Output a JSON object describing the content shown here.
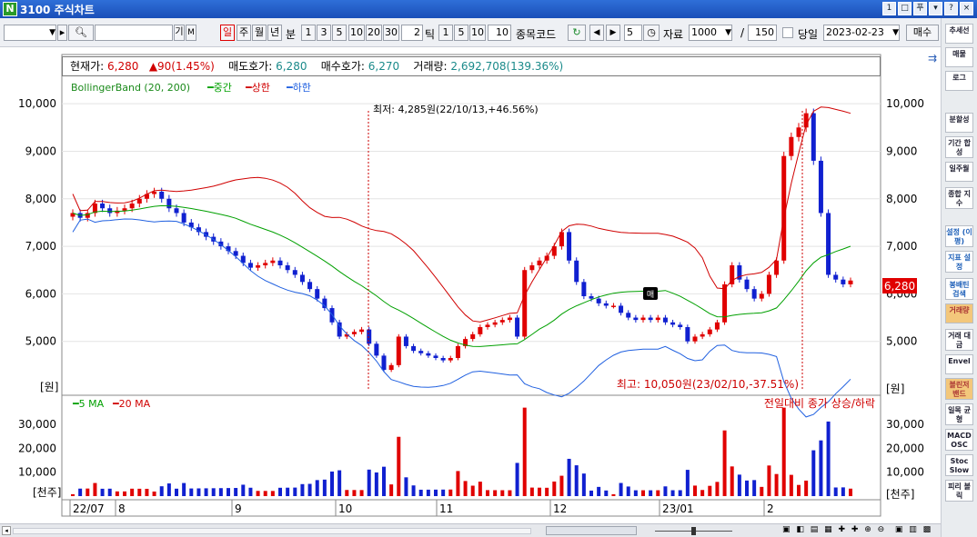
{
  "window": {
    "icon_letter": "N",
    "title": "3100 주식차트",
    "buttons": [
      "1",
      "□",
      "푸",
      "▾",
      "?",
      "×"
    ]
  },
  "toolbar": {
    "periods": [
      "일",
      "주",
      "월",
      "년",
      "분"
    ],
    "minute_values": [
      "1",
      "3",
      "5",
      "10",
      "20",
      "30"
    ],
    "tick_count": "2",
    "tick_label": "틱",
    "tick_values": [
      "1",
      "5",
      "10",
      "10"
    ],
    "code_label": "종목코드",
    "count_value": "5",
    "data_label": "자료",
    "data_count": "1000",
    "slash": "/",
    "view_count": "150",
    "today_label": "당일",
    "date_value": "2023-02-23",
    "trade_type": "매수"
  },
  "sidebar": [
    "추세선",
    "매물",
    "로그",
    "분할성",
    "기간 합성",
    "일주월",
    "종합 지수",
    "설정 (이평)",
    "지표 설정",
    "봉배틴 검색",
    "거래량",
    "거래 대금",
    "Envel",
    "볼린저 밴드",
    "일목 균형",
    "MACD OSC",
    "Stoc Slow",
    "피리 볼릭"
  ],
  "info": {
    "current_label": "현재가:",
    "current_value": "6,280",
    "change": "▲90(1.45%)",
    "ask_label": "매도호가:",
    "ask_value": "6,280",
    "bid_label": "매수호가:",
    "bid_value": "6,270",
    "volume_label": "거래량:",
    "volume_value": "2,692,708(139.36%)"
  },
  "legend": {
    "title": "BollingerBand (20, 200)",
    "mid": "━중간",
    "upper": "━상한",
    "lower": "━하한"
  },
  "annotations": {
    "low": "최저: 4,285원(22/10/13,+46.56%)",
    "high": "최고: 10,050원(23/02/10,-37.51%)",
    "price_tag": "6,280",
    "sell_tag": "매",
    "vol_note": "전일대비 종가 상승/하락"
  },
  "price_axis": {
    "ticks": [
      "10,000",
      "9,000",
      "8,000",
      "7,000",
      "6,000",
      "5,000"
    ],
    "unit": "[원]"
  },
  "volume_axis": {
    "ticks": [
      "30,000",
      "20,000",
      "10,000"
    ],
    "unit": "[천주]"
  },
  "volume_legend": {
    "ma5": "━5 MA",
    "ma20": "━20 MA"
  },
  "date_axis": [
    "22/07",
    "8",
    "9",
    "10",
    "11",
    "12",
    "23/01",
    "2"
  ],
  "colors": {
    "up": "#e00000",
    "down": "#1020d0",
    "mid": "#00a000",
    "upper": "#d00000",
    "lower": "#2060e0"
  },
  "chart_data": {
    "type": "candlestick",
    "price_range": [
      4000,
      10500
    ],
    "closes": [
      7700,
      7600,
      7700,
      7900,
      7800,
      7700,
      7750,
      7800,
      7900,
      8000,
      8100,
      8150,
      8000,
      7800,
      7700,
      7500,
      7400,
      7300,
      7200,
      7100,
      7000,
      6900,
      6800,
      6650,
      6550,
      6600,
      6650,
      6700,
      6600,
      6500,
      6400,
      6250,
      6100,
      5900,
      5700,
      5400,
      5100,
      5150,
      5200,
      5250,
      4950,
      4700,
      4400,
      4500,
      5100,
      4900,
      4800,
      4750,
      4700,
      4650,
      4600,
      4650,
      4900,
      5050,
      5150,
      5300,
      5350,
      5400,
      5450,
      5500,
      5100,
      6500,
      6600,
      6700,
      6800,
      7000,
      7300,
      6700,
      6250,
      5950,
      5900,
      5800,
      5750,
      5750,
      5600,
      5500,
      5450,
      5500,
      5450,
      5500,
      5400,
      5350,
      5300,
      5000,
      5100,
      5150,
      5250,
      5400,
      6200,
      6600,
      6300,
      6100,
      5900,
      6000,
      6400,
      6700,
      8900,
      9300,
      9500,
      9800,
      8800,
      7700,
      6400,
      6300,
      6200,
      6280
    ]
  }
}
